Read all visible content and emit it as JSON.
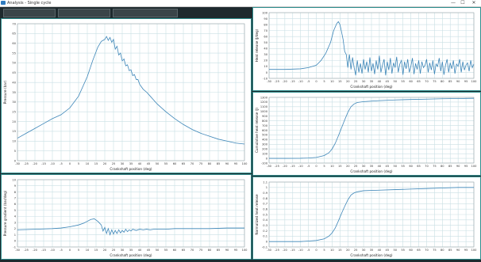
{
  "window": {
    "title": "Analysis - Single cycle",
    "minimize": "—",
    "maximize": "☐",
    "close": "✕"
  },
  "toolbar": {
    "buttons": [
      "",
      "",
      ""
    ]
  },
  "colors": {
    "line": "#3d86b8",
    "grid": "#c9dfe4",
    "frame": "#2f8f8f",
    "background": "#1e2a2e"
  },
  "chart_data": [
    {
      "id": "pressure",
      "type": "line",
      "title": "",
      "xlabel": "Crankshaft position (deg)",
      "ylabel": "Pressure (bar)",
      "xlim": [
        -30,
        100
      ],
      "ylim": [
        0,
        70
      ],
      "xticks": [
        -30,
        -25,
        -20,
        -15,
        -10,
        -5,
        0,
        5,
        10,
        15,
        20,
        25,
        30,
        35,
        40,
        45,
        50,
        55,
        60,
        65,
        70,
        75,
        80,
        85,
        90,
        95,
        100
      ],
      "yticks": [
        0,
        5,
        10,
        15,
        20,
        25,
        30,
        35,
        40,
        45,
        50,
        55,
        60,
        65,
        70
      ],
      "grid": true,
      "series": [
        {
          "x": [
            -30,
            -25,
            -20,
            -15,
            -10,
            -5,
            0,
            5,
            10,
            13,
            16,
            18,
            20,
            21,
            22,
            23,
            24,
            25,
            26,
            27,
            28,
            29,
            30,
            31,
            32,
            33,
            34,
            35,
            36,
            37,
            38,
            39,
            40,
            42,
            44,
            46,
            48,
            50,
            55,
            60,
            65,
            70,
            75,
            80,
            85,
            90,
            95,
            100
          ],
          "y": [
            11.5,
            14,
            16.5,
            19,
            21.5,
            23.5,
            27,
            33,
            43,
            51,
            58,
            61,
            62,
            63.5,
            61.5,
            63,
            60.5,
            62,
            57,
            58.5,
            54,
            55,
            51,
            52,
            48.5,
            49,
            46,
            46.5,
            43.5,
            44,
            41.5,
            41.5,
            39,
            36.5,
            35,
            33,
            31,
            29,
            25,
            21.5,
            18.5,
            16,
            14,
            12.5,
            11,
            10,
            9,
            8.5
          ]
        }
      ]
    },
    {
      "id": "heat-release",
      "type": "line",
      "title": "",
      "xlabel": "Crankshaft position (deg)",
      "ylabel": "Heat release (J/deg)",
      "xlim": [
        -30,
        100
      ],
      "ylim": [
        -10,
        100
      ],
      "xticks": [
        -30,
        -25,
        -20,
        -15,
        -10,
        -5,
        0,
        5,
        10,
        15,
        20,
        25,
        30,
        35,
        40,
        45,
        50,
        55,
        60,
        65,
        70,
        75,
        80,
        85,
        90,
        95,
        100
      ],
      "yticks": [
        -10,
        0,
        10,
        20,
        30,
        40,
        50,
        60,
        70,
        80,
        90,
        100
      ],
      "grid": true,
      "series": [
        {
          "x": [
            -30,
            -20,
            -10,
            -5,
            0,
            3,
            6,
            9,
            11,
            13,
            14,
            15,
            16,
            17,
            18,
            19,
            20,
            21,
            22,
            23,
            24,
            25,
            26,
            27,
            28,
            29,
            30,
            31,
            32,
            33,
            34,
            35,
            36,
            37,
            38,
            39,
            40,
            41,
            42,
            43,
            44,
            45,
            46,
            47,
            48,
            49,
            50,
            51,
            52,
            53,
            54,
            55,
            56,
            57,
            58,
            59,
            60,
            61,
            62,
            63,
            64,
            65,
            66,
            67,
            68,
            69,
            70,
            71,
            72,
            73,
            74,
            75,
            76,
            77,
            78,
            79,
            80,
            81,
            82,
            83,
            84,
            85,
            86,
            87,
            88,
            89,
            90,
            91,
            92,
            93,
            94,
            95,
            96,
            97,
            98,
            99,
            100
          ],
          "y": [
            5,
            5,
            6,
            8,
            12,
            20,
            32,
            50,
            70,
            82,
            85,
            80,
            68,
            55,
            35,
            30,
            8,
            30,
            5,
            25,
            8,
            -5,
            20,
            0,
            15,
            -2,
            22,
            5,
            18,
            0,
            25,
            2,
            15,
            -3,
            20,
            5,
            28,
            0,
            12,
            22,
            -5,
            18,
            4,
            24,
            -2,
            16,
            8,
            26,
            0,
            14,
            20,
            -4,
            18,
            6,
            22,
            0,
            10,
            24,
            -3,
            15,
            5,
            20,
            -2,
            18,
            8,
            12,
            22,
            0,
            16,
            4,
            20,
            -3,
            14,
            10,
            24,
            2,
            18,
            -4,
            12,
            22,
            0,
            16,
            6,
            20,
            -2,
            14,
            10,
            22,
            0,
            18,
            4,
            12,
            16,
            2,
            20,
            8,
            14
          ]
        }
      ]
    },
    {
      "id": "pressure-gradient",
      "type": "line",
      "title": "",
      "xlabel": "Crankshaft position (deg)",
      "ylabel": "Pressure gradient (bar/deg)",
      "xlim": [
        -30,
        100
      ],
      "ylim": [
        -1,
        10
      ],
      "xticks": [
        -30,
        -25,
        -20,
        -15,
        -10,
        -5,
        0,
        5,
        10,
        15,
        20,
        25,
        30,
        35,
        40,
        45,
        50,
        55,
        60,
        65,
        70,
        75,
        80,
        85,
        90,
        95,
        100
      ],
      "yticks": [
        -1,
        0,
        1,
        2,
        3,
        4,
        5,
        6,
        7,
        8,
        9,
        10
      ],
      "grid": true,
      "series": [
        {
          "x": [
            -30,
            -20,
            -10,
            -5,
            0,
            5,
            8,
            10,
            12,
            14,
            16,
            18,
            19,
            20,
            21,
            22,
            23,
            24,
            25,
            26,
            27,
            28,
            29,
            30,
            31,
            32,
            33,
            34,
            35,
            36,
            38,
            40,
            42,
            44,
            46,
            48,
            50,
            55,
            60,
            70,
            80,
            90,
            100
          ],
          "y": [
            1.8,
            1.9,
            2.0,
            2.1,
            2.3,
            2.6,
            2.9,
            3.2,
            3.5,
            3.6,
            3.2,
            2.6,
            1.6,
            2.2,
            1.2,
            2.0,
            1.0,
            1.8,
            1.1,
            1.7,
            1.2,
            1.8,
            1.3,
            1.7,
            1.4,
            1.9,
            1.5,
            1.8,
            1.6,
            1.9,
            1.7,
            1.9,
            1.8,
            1.9,
            1.8,
            1.9,
            1.9,
            1.9,
            2.0,
            2.0,
            2.0,
            2.1,
            2.1
          ]
        }
      ]
    },
    {
      "id": "cumulative-heat",
      "type": "line",
      "title": "",
      "xlabel": "Crankshaft position (deg)",
      "ylabel": "Cumulative heat release (J)",
      "xlim": [
        -30,
        100
      ],
      "ylim": [
        -100,
        1300
      ],
      "xticks": [
        -30,
        -25,
        -20,
        -15,
        -10,
        -5,
        0,
        5,
        10,
        15,
        20,
        25,
        30,
        35,
        40,
        45,
        50,
        55,
        60,
        65,
        70,
        75,
        80,
        85,
        90,
        95,
        100
      ],
      "yticks": [
        -100,
        0,
        100,
        200,
        300,
        400,
        500,
        600,
        700,
        800,
        900,
        1000,
        1100,
        1200,
        1300
      ],
      "grid": true,
      "series": [
        {
          "x": [
            -30,
            -20,
            -10,
            -5,
            0,
            5,
            8,
            10,
            12,
            14,
            16,
            18,
            20,
            22,
            24,
            26,
            30,
            40,
            50,
            60,
            70,
            80,
            90,
            100
          ],
          "y": [
            0,
            0,
            2,
            8,
            20,
            60,
            120,
            200,
            320,
            480,
            650,
            820,
            980,
            1100,
            1160,
            1190,
            1210,
            1230,
            1245,
            1255,
            1262,
            1270,
            1275,
            1280
          ]
        }
      ]
    },
    {
      "id": "normalized-heat",
      "type": "line",
      "title": "",
      "xlabel": "Crankshaft position (deg)",
      "ylabel": "Normalized heat release",
      "xlim": [
        -30,
        100
      ],
      "ylim": [
        -0.1,
        1.1
      ],
      "xticks": [
        -30,
        -25,
        -20,
        -15,
        -10,
        -5,
        0,
        5,
        10,
        15,
        20,
        25,
        30,
        35,
        40,
        45,
        50,
        55,
        60,
        65,
        70,
        75,
        80,
        85,
        90,
        95,
        100
      ],
      "yticks": [
        -0.1,
        0,
        0.1,
        0.2,
        0.3,
        0.4,
        0.5,
        0.6,
        0.7,
        0.8,
        0.9,
        1,
        1.1
      ],
      "grid": true,
      "series": [
        {
          "x": [
            -30,
            -20,
            -10,
            -5,
            0,
            5,
            8,
            10,
            12,
            14,
            16,
            18,
            20,
            22,
            24,
            26,
            30,
            40,
            50,
            60,
            70,
            80,
            90,
            100
          ],
          "y": [
            0,
            0,
            0,
            0.01,
            0.02,
            0.05,
            0.1,
            0.16,
            0.25,
            0.38,
            0.52,
            0.65,
            0.77,
            0.86,
            0.9,
            0.92,
            0.94,
            0.95,
            0.96,
            0.97,
            0.98,
            0.99,
            1.0,
            1.0
          ]
        }
      ]
    }
  ]
}
